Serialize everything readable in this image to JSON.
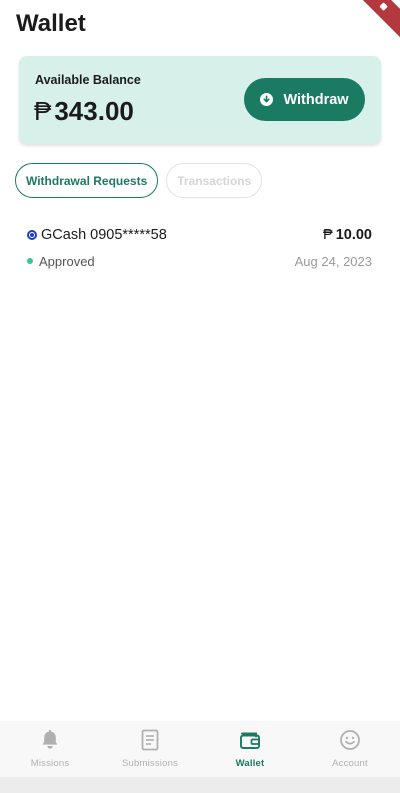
{
  "page": {
    "title": "Wallet"
  },
  "balance": {
    "label": "Available Balance",
    "currency": "₱",
    "amount": "343.00",
    "withdraw_label": "Withdraw"
  },
  "tabs": [
    {
      "label": "Withdrawal Requests",
      "active": true
    },
    {
      "label": "Transactions",
      "active": false
    }
  ],
  "requests": [
    {
      "method": "GCash 0905*****58",
      "currency": "₱",
      "amount": "10.00",
      "status": "Approved",
      "date": "Aug 24, 2023"
    }
  ],
  "nav": {
    "items": [
      {
        "label": "Missions",
        "icon": "bell-icon"
      },
      {
        "label": "Submissions",
        "icon": "document-icon"
      },
      {
        "label": "Wallet",
        "icon": "wallet-icon",
        "active": true
      },
      {
        "label": "Account",
        "icon": "smiley-icon"
      }
    ]
  },
  "colors": {
    "brand": "#1b7a62",
    "card_bg": "#d7f0ea",
    "status_approved": "#35c59a",
    "gcash_blue": "#1d3fbf"
  }
}
